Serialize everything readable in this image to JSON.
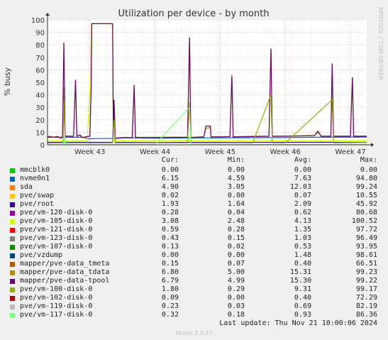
{
  "chart_data": {
    "type": "line",
    "title": "Utilization per device - by month",
    "ylabel": "% busy",
    "side_label": "RRDTOOL / TOBI OETIKER",
    "ylim": [
      0,
      100
    ],
    "yticks": [
      0,
      10,
      20,
      30,
      40,
      50,
      60,
      70,
      80,
      90,
      100
    ],
    "xlim": [
      42.35,
      47.25
    ],
    "xticks": [
      {
        "v": 43,
        "label": "Week 43"
      },
      {
        "v": 44,
        "label": "Week 44"
      },
      {
        "v": 45,
        "label": "Week 45"
      },
      {
        "v": 46,
        "label": "Week 46"
      },
      {
        "v": 47,
        "label": "Week 47"
      }
    ],
    "headers": {
      "cur": "Cur:",
      "min": "Min:",
      "avg": "Avg:",
      "max": "Max:"
    },
    "series": [
      {
        "name": "mmcblk0",
        "color": "#00cc00",
        "cur": "0.00",
        "min": "0.00",
        "avg": "0.00",
        "max": "0.00"
      },
      {
        "name": "nvme0n1",
        "color": "#0066b3",
        "cur": "6.15",
        "min": "4.59",
        "avg": "7.63",
        "max": "94.80",
        "points": [
          [
            42.35,
            6
          ],
          [
            42.9,
            6
          ],
          [
            42.97,
            4.8
          ],
          [
            43.1,
            5
          ],
          [
            43.2,
            5
          ],
          [
            43.45,
            5.2
          ],
          [
            43.55,
            5.6
          ],
          [
            44.0,
            5.2
          ],
          [
            44.5,
            5.5
          ],
          [
            45.0,
            5.5
          ],
          [
            45.5,
            5.7
          ],
          [
            46.0,
            5.8
          ],
          [
            46.5,
            6
          ],
          [
            47.25,
            6.2
          ]
        ]
      },
      {
        "name": "sda",
        "color": "#ff8000",
        "cur": "4.90",
        "min": "3.05",
        "avg": "12.03",
        "max": "99.24"
      },
      {
        "name": "pve/swap",
        "color": "#ffcc00",
        "cur": "0.02",
        "min": "0.00",
        "avg": "0.07",
        "max": "10.55"
      },
      {
        "name": "pve/root",
        "color": "#330099",
        "cur": "1.93",
        "min": "1.64",
        "avg": "2.09",
        "max": "45.92",
        "points": [
          [
            42.35,
            2
          ],
          [
            43.35,
            2
          ],
          [
            43.37,
            36
          ],
          [
            43.39,
            2
          ],
          [
            44.0,
            1.8
          ],
          [
            44.6,
            2
          ],
          [
            45.2,
            1.9
          ],
          [
            46.0,
            2
          ],
          [
            46.7,
            2
          ],
          [
            47.25,
            2
          ]
        ]
      },
      {
        "name": "pve/vm-120-disk-0",
        "color": "#990099",
        "cur": "0.28",
        "min": "0.04",
        "avg": "0.62",
        "max": "80.68"
      },
      {
        "name": "pve/vm-105-disk-0",
        "color": "#ccff00",
        "cur": "3.08",
        "min": "2.48",
        "avg": "4.13",
        "max": "100.52",
        "points": [
          [
            42.35,
            3
          ],
          [
            42.96,
            3
          ],
          [
            43.0,
            45
          ],
          [
            43.03,
            97
          ],
          [
            43.35,
            97
          ],
          [
            43.36,
            3.2
          ],
          [
            44.0,
            3.2
          ],
          [
            45.0,
            3.2
          ],
          [
            46.0,
            3.2
          ],
          [
            47.25,
            3.2
          ]
        ]
      },
      {
        "name": "pve/vm-121-disk-0",
        "color": "#ff0000",
        "cur": "0.59",
        "min": "0.28",
        "avg": "1.35",
        "max": "97.72"
      },
      {
        "name": "pve/vm-123-disk-0",
        "color": "#808080",
        "cur": "0.43",
        "min": "0.15",
        "avg": "1.03",
        "max": "96.49"
      },
      {
        "name": "pve/vm-107-disk-0",
        "color": "#008f00",
        "cur": "0.13",
        "min": "0.02",
        "avg": "0.53",
        "max": "93.95"
      },
      {
        "name": "pve/vzdump",
        "color": "#00487d",
        "cur": "0.00",
        "min": "0.00",
        "avg": "1.48",
        "max": "98.61"
      },
      {
        "name": "mapper/pve-data_tmeta",
        "color": "#b35a00",
        "cur": "0.15",
        "min": "0.07",
        "avg": "0.40",
        "max": "66.51"
      },
      {
        "name": "mapper/pve-data_tdata",
        "color": "#b38f00",
        "cur": "6.80",
        "min": "5.00",
        "avg": "15.31",
        "max": "99.23",
        "points": [
          [
            42.35,
            7
          ],
          [
            42.45,
            6.2
          ],
          [
            42.5,
            6.8
          ],
          [
            42.56,
            5.5
          ],
          [
            42.58,
            7
          ],
          [
            42.6,
            46
          ],
          [
            42.62,
            7
          ],
          [
            42.75,
            7
          ],
          [
            42.78,
            52
          ],
          [
            42.8,
            7
          ],
          [
            42.85,
            8
          ],
          [
            42.88,
            6
          ],
          [
            43.0,
            7
          ],
          [
            43.02,
            45
          ],
          [
            43.03,
            97
          ],
          [
            43.35,
            97
          ],
          [
            43.36,
            6.5
          ],
          [
            43.37,
            36
          ],
          [
            43.39,
            5.5
          ],
          [
            43.55,
            6
          ],
          [
            43.65,
            5.8
          ],
          [
            43.68,
            47
          ],
          [
            43.7,
            6
          ],
          [
            44.0,
            6
          ],
          [
            44.5,
            6.2
          ],
          [
            44.53,
            86
          ],
          [
            44.55,
            6
          ],
          [
            44.75,
            6.5
          ],
          [
            44.78,
            13
          ],
          [
            44.85,
            14
          ],
          [
            44.86,
            6.5
          ],
          [
            45.0,
            6.5
          ],
          [
            45.15,
            6.7
          ],
          [
            45.18,
            56
          ],
          [
            45.2,
            6.5
          ],
          [
            45.5,
            6.8
          ],
          [
            45.75,
            7
          ],
          [
            45.78,
            77
          ],
          [
            45.8,
            7
          ],
          [
            46.0,
            7
          ],
          [
            46.45,
            7.5
          ],
          [
            46.5,
            10
          ],
          [
            46.55,
            7
          ],
          [
            46.7,
            7
          ],
          [
            46.72,
            65
          ],
          [
            46.74,
            7
          ],
          [
            47.0,
            7
          ],
          [
            47.03,
            54
          ],
          [
            47.05,
            7
          ],
          [
            47.25,
            7
          ]
        ]
      },
      {
        "name": "mapper/pve-data-tpool",
        "color": "#6b006b",
        "cur": "6.79",
        "min": "4.99",
        "avg": "15.30",
        "max": "99.22",
        "points": [
          [
            42.35,
            6.5
          ],
          [
            42.45,
            6
          ],
          [
            42.5,
            6.6
          ],
          [
            42.56,
            5.3
          ],
          [
            42.58,
            7
          ],
          [
            42.6,
            82
          ],
          [
            42.62,
            6.8
          ],
          [
            42.75,
            6.8
          ],
          [
            42.78,
            52
          ],
          [
            42.8,
            6.8
          ],
          [
            42.85,
            7.8
          ],
          [
            42.88,
            5.8
          ],
          [
            43.0,
            6.8
          ],
          [
            43.02,
            45
          ],
          [
            43.03,
            97
          ],
          [
            43.35,
            97
          ],
          [
            43.36,
            6.3
          ],
          [
            43.37,
            36
          ],
          [
            43.39,
            5.3
          ],
          [
            43.55,
            5.8
          ],
          [
            43.65,
            5.6
          ],
          [
            43.68,
            48
          ],
          [
            43.7,
            5.8
          ],
          [
            44.0,
            5.8
          ],
          [
            44.5,
            6
          ],
          [
            44.53,
            86
          ],
          [
            44.55,
            5.8
          ],
          [
            44.75,
            6.3
          ],
          [
            44.78,
            15
          ],
          [
            44.85,
            15
          ],
          [
            44.86,
            6.3
          ],
          [
            45.0,
            6.3
          ],
          [
            45.15,
            6.5
          ],
          [
            45.18,
            55
          ],
          [
            45.2,
            6.3
          ],
          [
            45.5,
            6.6
          ],
          [
            45.75,
            6.8
          ],
          [
            45.78,
            77
          ],
          [
            45.8,
            6.8
          ],
          [
            46.0,
            6.8
          ],
          [
            46.45,
            7.3
          ],
          [
            46.5,
            11
          ],
          [
            46.55,
            6.8
          ],
          [
            46.7,
            6.8
          ],
          [
            46.72,
            65
          ],
          [
            46.74,
            6.8
          ],
          [
            47.0,
            6.8
          ],
          [
            47.03,
            54
          ],
          [
            47.05,
            6.8
          ],
          [
            47.25,
            6.8
          ]
        ]
      },
      {
        "name": "pve/vm-100-disk-0",
        "color": "#8fb300",
        "cur": "1.80",
        "min": "0.29",
        "avg": "9.31",
        "max": "99.17",
        "points": [
          [
            42.35,
            1.5
          ],
          [
            42.59,
            1.5
          ],
          [
            42.6,
            36
          ],
          [
            42.62,
            1.5
          ],
          [
            43.0,
            1.5
          ],
          [
            43.35,
            1.5
          ],
          [
            43.37,
            20
          ],
          [
            43.39,
            1.5
          ],
          [
            44.0,
            1.5
          ],
          [
            44.5,
            1.5
          ],
          [
            44.53,
            34
          ],
          [
            44.55,
            1.5
          ],
          [
            45.0,
            1.5
          ],
          [
            45.5,
            1.5
          ],
          [
            45.78,
            40
          ],
          [
            45.8,
            1.5
          ],
          [
            46.0,
            1.5
          ],
          [
            46.72,
            36
          ],
          [
            46.74,
            1.5
          ],
          [
            47.25,
            1.8
          ]
        ]
      },
      {
        "name": "pve/vm-102-disk-0",
        "color": "#b30000",
        "cur": "0.09",
        "min": "0.00",
        "avg": "0.40",
        "max": "72.29"
      },
      {
        "name": "pve/vm-119-disk-0",
        "color": "#bebebe",
        "cur": "0.23",
        "min": "0.03",
        "avg": "0.69",
        "max": "82.19"
      },
      {
        "name": "pve/vm-117-disk-0",
        "color": "#80ff80",
        "cur": "0.32",
        "min": "0.18",
        "avg": "0.93",
        "max": "86.36",
        "points": [
          [
            42.35,
            0.3
          ],
          [
            42.6,
            0.3
          ],
          [
            42.61,
            7
          ],
          [
            42.63,
            0.3
          ],
          [
            43.0,
            0.3
          ],
          [
            44.0,
            0.3
          ],
          [
            44.53,
            30
          ],
          [
            44.55,
            0.3
          ],
          [
            45.0,
            0.3
          ],
          [
            46.0,
            0.3
          ],
          [
            47.25,
            0.3
          ]
        ]
      }
    ]
  },
  "footer": "Last update:  Thu Nov 21 10:00:06 2024",
  "munin": "Munin 2.0.67"
}
